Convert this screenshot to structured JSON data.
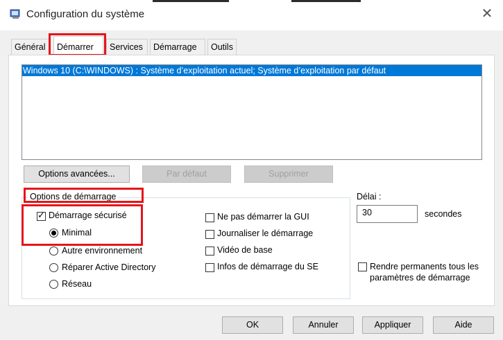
{
  "window": {
    "title": "Configuration du système"
  },
  "tabs": [
    "Général",
    "Démarrer",
    "Services",
    "Démarrage",
    "Outils"
  ],
  "os_list": {
    "items": [
      "Windows 10 (C:\\WINDOWS) : Système d’exploitation actuel; Système d’exploitation par défaut"
    ]
  },
  "os_buttons": {
    "advanced": "Options avancées...",
    "default": "Par défaut",
    "delete": "Supprimer"
  },
  "boot_options": {
    "group_label": "Options de démarrage",
    "safe_boot": {
      "label": "Démarrage sécurisé",
      "checked": true
    },
    "radios": [
      "Minimal",
      "Autre environnement",
      "Réparer Active Directory",
      "Réseau"
    ],
    "selected_radio": "Minimal",
    "checkboxes": [
      "Ne pas démarrer la GUI",
      "Journaliser le démarrage",
      "Vidéo de base",
      "Infos de démarrage du SE"
    ]
  },
  "timeout": {
    "label": "Délai :",
    "value": "30",
    "unit": "secondes"
  },
  "permanent": {
    "label_line1": "Rendre permanents tous les",
    "label_line2": "paramètres de démarrage"
  },
  "footer_buttons": {
    "ok": "OK",
    "cancel": "Annuler",
    "apply": "Appliquer",
    "help": "Aide"
  },
  "colors": {
    "selection": "#0078d7",
    "highlight_box": "#e4151a"
  },
  "icons": {
    "app": "msconfig-icon",
    "close": "close-icon"
  }
}
